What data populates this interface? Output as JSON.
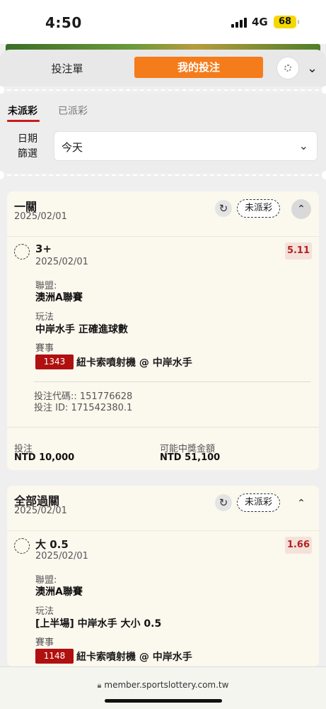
{
  "status_bar": {
    "time": "4:50",
    "network": "4G",
    "battery": "68"
  },
  "header": {
    "tab_betslip": "投注單",
    "tab_mybets": "我的投注",
    "settings_icon": "settings-icon",
    "chevron_icon": "chevron-down-icon"
  },
  "subtabs": {
    "unsettled": "未派彩",
    "settled": "已派彩"
  },
  "filter": {
    "label": "日期\n篩選",
    "label_line1": "日期",
    "label_line2": "篩選",
    "value": "今天"
  },
  "bets": [
    {
      "type": "一關",
      "date": "2025/02/01",
      "status": "未派彩",
      "selection": {
        "name": "3+",
        "date": "2025/02/01",
        "odds": "5.11"
      },
      "league_label": "聯盟:",
      "league": "澳洲A聯賽",
      "market_label": "玩法",
      "market": "中岸水手 正確進球數",
      "event_label": "賽事",
      "event_id": "1343",
      "event": "紐卡索噴射機 @ 中岸水手",
      "bet_code": "投注代碼:: 151776628",
      "bet_id": "投注 ID: 171542380.1",
      "stake_label": "投注",
      "stake": "NTD 10,000",
      "payout_label": "可能中獎金額",
      "payout": "NTD 51,100"
    },
    {
      "type": "全部過關",
      "date": "2025/02/01",
      "status": "未派彩",
      "selection": {
        "name": "大 0.5",
        "date": "2025/02/01",
        "odds": "1.66"
      },
      "league_label": "聯盟:",
      "league": "澳洲A聯賽",
      "market_label": "玩法",
      "market": "[上半場] 中岸水手 大小 0.5",
      "event_label": "賽事",
      "event_id": "1148",
      "event": "紐卡索噴射機 @ 中岸水手"
    }
  ],
  "browser": {
    "url": "member.sportslottery.com.tw"
  }
}
